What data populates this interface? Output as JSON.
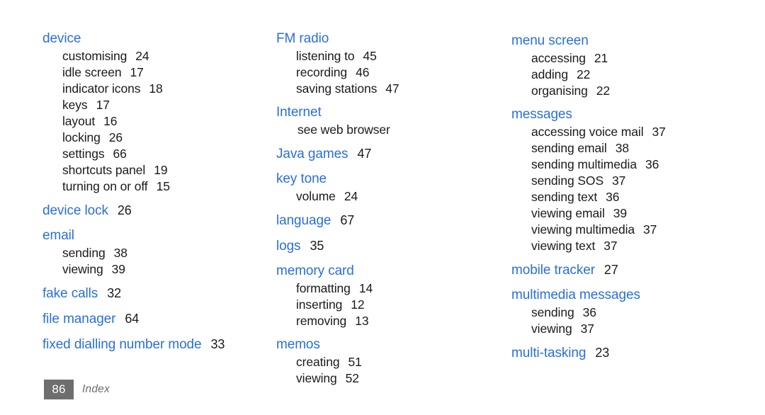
{
  "page": {
    "footer": {
      "folio": "86",
      "section_label": "Index"
    },
    "accent_color": "#2a6fdb",
    "text_color": "#1a1a1a",
    "folio_bg_color": "#6e6e6e"
  },
  "columns": [
    {
      "id": "column-1",
      "groups": [
        {
          "main": {
            "label": "device",
            "page": ""
          },
          "subs": [
            {
              "label": "customising",
              "page": "24"
            },
            {
              "label": "idle screen",
              "page": "17"
            },
            {
              "label": "indicator icons",
              "page": "18"
            },
            {
              "label": "keys",
              "page": "17"
            },
            {
              "label": "layout",
              "page": "16"
            },
            {
              "label": "locking",
              "page": "26"
            },
            {
              "label": "settings",
              "page": "66"
            },
            {
              "label": "shortcuts panel",
              "page": "19"
            },
            {
              "label": "turning on or off",
              "page": "15"
            }
          ]
        },
        {
          "main": {
            "label": "device lock",
            "page": "26"
          },
          "subs": []
        },
        {
          "main": {
            "label": "email",
            "page": ""
          },
          "subs": [
            {
              "label": "sending",
              "page": "38"
            },
            {
              "label": "viewing",
              "page": "39"
            }
          ]
        },
        {
          "main": {
            "label": "fake calls",
            "page": "32"
          },
          "subs": []
        },
        {
          "main": {
            "label": "file manager",
            "page": "64"
          },
          "subs": []
        },
        {
          "main": {
            "label": "fixed dialling number mode",
            "page": "33"
          },
          "subs": []
        }
      ]
    },
    {
      "id": "column-2",
      "groups": [
        {
          "main": {
            "label": "FM radio",
            "page": ""
          },
          "subs": [
            {
              "label": "listening to",
              "page": "45"
            },
            {
              "label": "recording",
              "page": "46"
            },
            {
              "label": "saving stations",
              "page": "47"
            }
          ]
        },
        {
          "main": {
            "label": "Internet",
            "page": ""
          },
          "subs": [
            {
              "label": "see web browser",
              "page": "",
              "cross_reference": true
            }
          ]
        },
        {
          "main": {
            "label": "Java games",
            "page": "47"
          },
          "subs": []
        },
        {
          "main": {
            "label": "key tone",
            "page": ""
          },
          "subs": [
            {
              "label": "volume",
              "page": "24"
            }
          ]
        },
        {
          "main": {
            "label": "language",
            "page": "67"
          },
          "subs": []
        },
        {
          "main": {
            "label": "logs",
            "page": "35"
          },
          "subs": []
        },
        {
          "main": {
            "label": "memory card",
            "page": ""
          },
          "subs": [
            {
              "label": "formatting",
              "page": "14"
            },
            {
              "label": "inserting",
              "page": "12"
            },
            {
              "label": "removing",
              "page": "13"
            }
          ]
        },
        {
          "main": {
            "label": "memos",
            "page": ""
          },
          "subs": [
            {
              "label": "creating",
              "page": "51"
            },
            {
              "label": "viewing",
              "page": "52"
            }
          ]
        }
      ]
    },
    {
      "id": "column-3",
      "groups": [
        {
          "main": {
            "label": "menu screen",
            "page": ""
          },
          "subs": [
            {
              "label": "accessing",
              "page": "21"
            },
            {
              "label": "adding",
              "page": "22"
            },
            {
              "label": "organising",
              "page": "22"
            }
          ]
        },
        {
          "main": {
            "label": "messages",
            "page": ""
          },
          "subs": [
            {
              "label": "accessing voice mail",
              "page": "37"
            },
            {
              "label": "sending email",
              "page": "38"
            },
            {
              "label": "sending multimedia",
              "page": "36"
            },
            {
              "label": "sending SOS",
              "page": "37"
            },
            {
              "label": "sending text",
              "page": "36"
            },
            {
              "label": "viewing email",
              "page": "39"
            },
            {
              "label": "viewing multimedia",
              "page": "37"
            },
            {
              "label": "viewing text",
              "page": "37"
            }
          ]
        },
        {
          "main": {
            "label": "mobile tracker",
            "page": "27"
          },
          "subs": []
        },
        {
          "main": {
            "label": "multimedia messages",
            "page": ""
          },
          "subs": [
            {
              "label": "sending",
              "page": "36"
            },
            {
              "label": "viewing",
              "page": "37"
            }
          ]
        },
        {
          "main": {
            "label": "multi-tasking",
            "page": "23"
          },
          "subs": []
        }
      ]
    }
  ]
}
